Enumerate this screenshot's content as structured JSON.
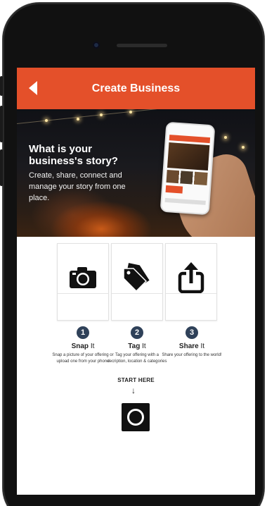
{
  "header": {
    "title": "Create Business",
    "back_icon": "chevron-left-icon"
  },
  "hero": {
    "title": "What is your business's story?",
    "subtitle": "Create, share, connect and manage your story from one place."
  },
  "steps": [
    {
      "number": "1",
      "title_bold": "Snap",
      "title_rest": " It",
      "description": "Snap a picture of your offering or upload one from your phone",
      "icon": "camera-icon"
    },
    {
      "number": "2",
      "title_bold": "Tag",
      "title_rest": " It",
      "description": "Tag your offering with a decription, location & categories",
      "icon": "tag-icon"
    },
    {
      "number": "3",
      "title_bold": "Share",
      "title_rest": " It",
      "description": "Share your offering to the world!",
      "icon": "share-icon"
    }
  ],
  "start": {
    "label": "START HERE",
    "arrow": "↓"
  },
  "colors": {
    "accent": "#e4502a",
    "step_badge": "#2f4159",
    "button": "#111111"
  }
}
